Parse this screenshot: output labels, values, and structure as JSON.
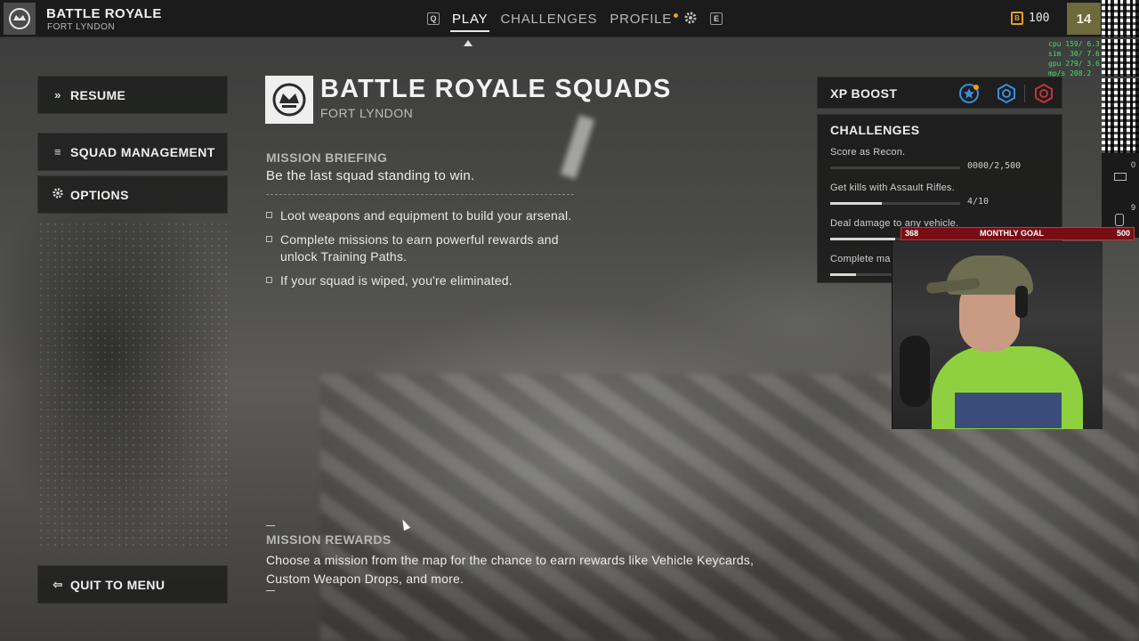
{
  "header": {
    "mode_title": "BATTLE ROYALE",
    "mode_subtitle": "FORT LYNDON",
    "nav": {
      "left_key": "Q",
      "tabs": [
        {
          "label": "PLAY",
          "active": true
        },
        {
          "label": "CHALLENGES",
          "active": false
        },
        {
          "label": "PROFILE",
          "active": false,
          "notification": true
        }
      ],
      "right_key": "E"
    },
    "currency": {
      "icon": "coin-icon",
      "symbol": "B",
      "value": "100"
    },
    "level": "14"
  },
  "perf_overlay": [
    "cpu 159/ 6.3",
    "sim  30/ 7.6",
    "gpu 279/ 3.6",
    "mp/s 208.2"
  ],
  "side_counts": [
    "0",
    "9"
  ],
  "menu": {
    "resume": "RESUME",
    "squad_management": "SQUAD MANAGEMENT",
    "options": "OPTIONS",
    "quit": "QUIT TO MENU"
  },
  "mission": {
    "title": "BATTLE ROYALE SQUADS",
    "subtitle": "FORT LYNDON",
    "briefing_label": "MISSION BRIEFING",
    "briefing_text": "Be the last squad standing to win.",
    "bullets": [
      "Loot weapons and equipment to build your arsenal.",
      "Complete missions to earn powerful rewards and unlock Training Paths.",
      "If your squad is wiped, you're eliminated."
    ],
    "rewards_label": "MISSION REWARDS",
    "rewards_text": "Choose a mission from the map for the chance to earn rewards like Vehicle Keycards, Custom Weapon Drops, and more."
  },
  "xp_boost": {
    "label": "XP BOOST",
    "icons": [
      "star-boost-icon",
      "weapon-boost-icon",
      "battle-pass-boost-icon"
    ],
    "colors": {
      "blue": "#3a8fe0",
      "red": "#c0353a",
      "orange": "#f29b1d"
    }
  },
  "challenges": {
    "title": "CHALLENGES",
    "items": [
      {
        "name": "Score as Recon.",
        "progress": "0000/2,500",
        "fraction": 0.0
      },
      {
        "name": "Get kills with Assault Rifles.",
        "progress": "4/10",
        "fraction": 0.4
      },
      {
        "name": "Deal damage to any vehicle.",
        "progress": "",
        "fraction": 0.5
      },
      {
        "name": "Complete ma",
        "progress": "",
        "fraction": 0.2
      }
    ]
  },
  "stream_goal": {
    "current": "368",
    "label": "MONTHLY GOAL",
    "target": "500",
    "color": "#7a0d14"
  }
}
